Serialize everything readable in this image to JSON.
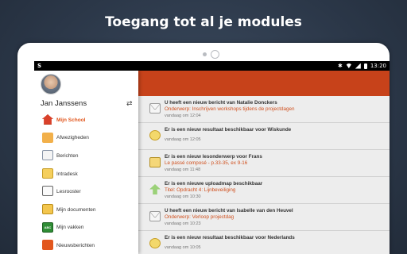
{
  "headline": "Toegang tot al je modules",
  "status_bar": {
    "app_icon": "S",
    "time": "13:20",
    "icons": [
      "bluetooth-icon",
      "wifi-icon",
      "signal-icon",
      "battery-icon"
    ]
  },
  "drawer": {
    "user_name": "Jan Janssens",
    "switch_icon": "⇄",
    "items": [
      {
        "label": "Mijn School",
        "icon": "home-icon",
        "active": true
      },
      {
        "label": "Afwezigheden",
        "icon": "absence-icon",
        "active": false
      },
      {
        "label": "Berichten",
        "icon": "messages-icon",
        "active": false
      },
      {
        "label": "Intradesk",
        "icon": "intradesk-icon",
        "active": false
      },
      {
        "label": "Lesrooster",
        "icon": "clock-icon",
        "active": false
      },
      {
        "label": "Mijn documenten",
        "icon": "folder-icon",
        "active": false
      },
      {
        "label": "Mijn vakken",
        "icon": "chalkboard-icon",
        "active": false
      },
      {
        "label": "Nieuwsberichten",
        "icon": "news-icon",
        "active": false
      }
    ]
  },
  "feed": [
    {
      "title": "U heeft een nieuw bericht van Natalie Donckers",
      "subtitle": "Onderwerp: Inschrijven workshops tijdens de projectdagen",
      "date": "vandaag om 12:04",
      "icon": "message-icon"
    },
    {
      "title": "Er is een nieuw resultaat beschikbaar voor Wiskunde",
      "subtitle": "",
      "date": "vandaag om 12:05",
      "icon": "result-icon"
    },
    {
      "title": "Er is een nieuw lesonderwerp voor Frans",
      "subtitle": "Le passé composé - p.33-35, ex 9-16",
      "date": "vandaag om 11:48",
      "icon": "lesson-icon"
    },
    {
      "title": "Er is een nieuwe uploadmap beschikbaar",
      "subtitle": "Titel: Opdracht 4: Lijnbeveiliging",
      "date": "vandaag om 10:30",
      "icon": "upload-icon"
    },
    {
      "title": "U heeft een nieuw bericht van Isabelle van den Heuvel",
      "subtitle": "Onderwerp: Verloop projectdag",
      "date": "vandaag om 10:23",
      "icon": "message-icon"
    },
    {
      "title": "Er is een nieuw resultaat beschikbaar voor Nederlands",
      "subtitle": "",
      "date": "vandaag om 10:05",
      "icon": "result-icon"
    }
  ],
  "colors": {
    "accent": "#c7421a",
    "active_menu": "#e2571e",
    "background": "#2b3748"
  }
}
